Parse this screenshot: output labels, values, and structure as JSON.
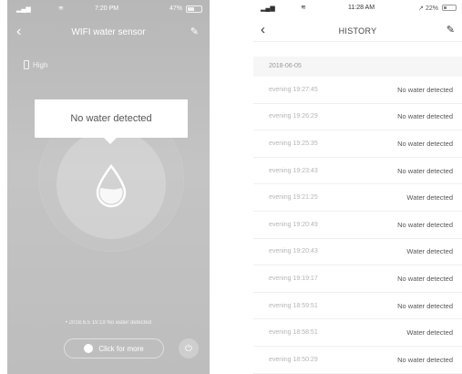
{
  "left": {
    "status_bar": {
      "time": "7:20 PM",
      "battery": "47%"
    },
    "nav": {
      "title": "WIFI water sensor"
    },
    "battery_level": "High",
    "status_message": "No water detected",
    "last_event": "• 2018.6.5 19:19 No water detected",
    "more_button": "Click for more"
  },
  "right": {
    "status_bar": {
      "time": "11:28 AM",
      "battery": "↗ 22%"
    },
    "nav": {
      "title": "HISTORY"
    },
    "date_header": "2018-06-05",
    "rows": [
      {
        "time": "evening 19:27:45",
        "status": "No water detected"
      },
      {
        "time": "evening 19:26:29",
        "status": "No water detected"
      },
      {
        "time": "evening 19:25:35",
        "status": "No water detected"
      },
      {
        "time": "evening 19:23:43",
        "status": "No water detected"
      },
      {
        "time": "evening 19:21:25",
        "status": "Water detected"
      },
      {
        "time": "evening 19:20:49",
        "status": "No water detected"
      },
      {
        "time": "evening 19:20:43",
        "status": "Water detected"
      },
      {
        "time": "evening 19:19:17",
        "status": "No water detected"
      },
      {
        "time": "evening 18:59:51",
        "status": "No water detected"
      },
      {
        "time": "evening 18:58:51",
        "status": "Water detected"
      },
      {
        "time": "evening 18:50:29",
        "status": "No water detected"
      }
    ]
  }
}
